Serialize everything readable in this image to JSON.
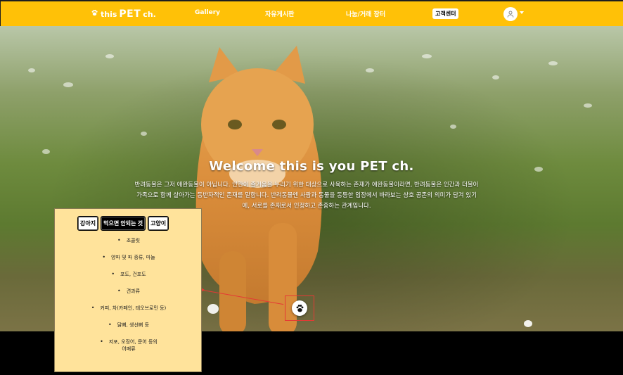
{
  "nav": {
    "brand": {
      "this": "this",
      "pet": "PET",
      "ch": "ch.",
      "icon": "paw-icon"
    },
    "links": [
      "Gallery",
      "자유게시판",
      "나눔/거래 장터"
    ],
    "support": "고객센터",
    "user_icon": "user-icon"
  },
  "hero": {
    "title": "Welcome this is you PET ch.",
    "description_lines": [
      "반려동물은 그저 애완동물이 아닙니다. 인간이 즐거움을 누리기 위한 대상으로 사육하는 존재가 애완동물이라면, 반려동물은 인간과 더불어",
      "가족으로 함께 살아가는 동반자적인 존재를 말합니다. 반려동물엔 사람과 동물을 동등한 입장에서 바라보는 상호 공존의 의미가 담겨 있기",
      "에, 서로를 존재로서 인정하고 존중하는 관계입니다."
    ]
  },
  "popup": {
    "tabs": [
      "강아지",
      "먹으면 안되는 것",
      "고양이"
    ],
    "active_tab": 1,
    "items": [
      "초콜릿",
      "양파 및 파 종류, 마늘",
      "포도, 건포도",
      "견과류",
      "커피, 차(카페인, 테오브로민 등)",
      "닭뼈, 생선뼈 등",
      [
        "저포, 오징어, 문어 등의",
        "어패류"
      ]
    ]
  },
  "paw_button_icon": "paw-icon",
  "colors": {
    "navbar": "#ffc107",
    "popup": "#ffe39b",
    "highlight": "#e53935"
  }
}
